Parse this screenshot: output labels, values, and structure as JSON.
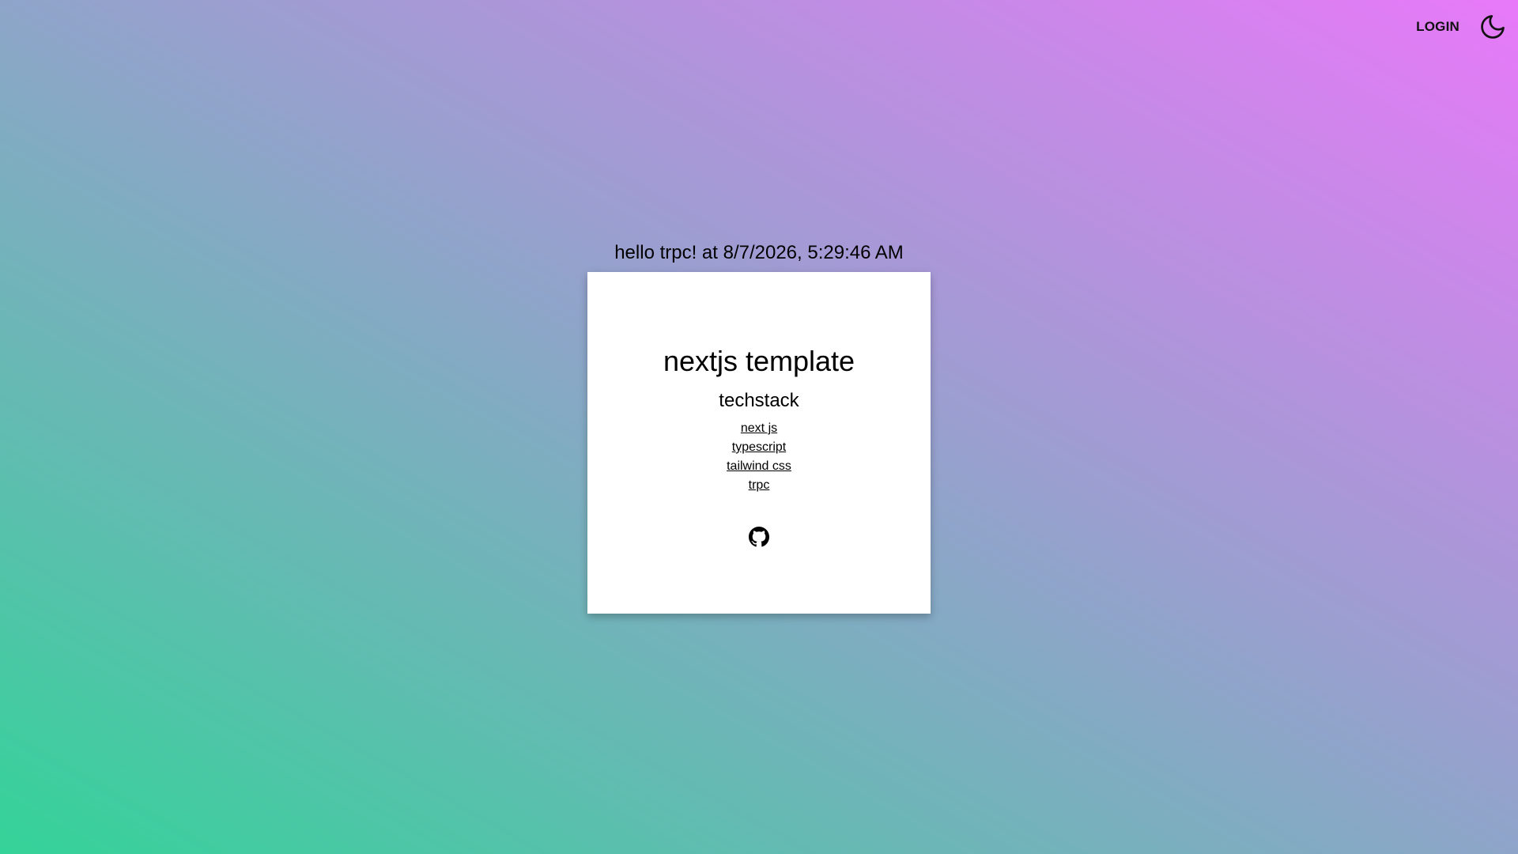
{
  "nav": {
    "login_label": "LOGIN",
    "theme_icon": "moon-icon"
  },
  "main": {
    "greeting": "hello trpc! at 8/7/2026, 5:29:46 AM",
    "card": {
      "title": "nextjs template",
      "subtitle": "techstack",
      "items": [
        {
          "label": "next js"
        },
        {
          "label": "typescript"
        },
        {
          "label": "tailwind css"
        },
        {
          "label": "trpc"
        }
      ],
      "github_icon": "github-icon"
    }
  },
  "colors": {
    "gradient_start": "#34d399",
    "gradient_mid": "#8ea5c9",
    "gradient_end": "#e879f9",
    "card_background": "#ffffff"
  }
}
